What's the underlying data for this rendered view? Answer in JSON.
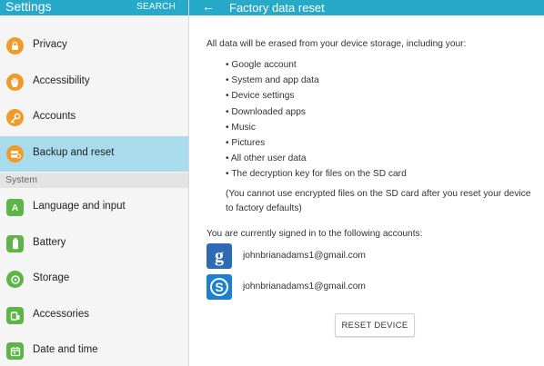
{
  "left_pane": {
    "title": "Settings",
    "search_label": "SEARCH",
    "section_label": "System",
    "items_top": [
      {
        "label": "Privacy",
        "icon": "privacy-icon",
        "color": "#f29a28"
      },
      {
        "label": "Accessibility",
        "icon": "hand-icon",
        "color": "#f29a28"
      },
      {
        "label": "Accounts",
        "icon": "key-icon",
        "color": "#f29a28"
      },
      {
        "label": "Backup and reset",
        "icon": "backup-icon",
        "color": "#f29a28",
        "selected": true
      }
    ],
    "items_system": [
      {
        "label": "Language and input",
        "icon": "language-icon",
        "color": "#5cb646"
      },
      {
        "label": "Battery",
        "icon": "battery-icon",
        "color": "#5cb646"
      },
      {
        "label": "Storage",
        "icon": "storage-icon",
        "color": "#5cb646"
      },
      {
        "label": "Accessories",
        "icon": "accessories-icon",
        "color": "#5cb646"
      },
      {
        "label": "Date and time",
        "icon": "calendar-icon",
        "color": "#5cb646"
      }
    ]
  },
  "right_pane": {
    "title": "Factory data reset",
    "intro": "All data will be erased from your device storage, including your:",
    "bullets": [
      "• Google account",
      "• System and app data",
      "• Device settings",
      "• Downloaded apps",
      "• Music",
      "• Pictures",
      "• All other user data",
      "• The decryption key for files on the SD card"
    ],
    "note": "(You cannot use encrypted files on the SD card after you reset your device to factory defaults)",
    "signed_in_text": "You are currently signed in to the following accounts:",
    "accounts": [
      {
        "email": "johnbrianadams1@gmail.com",
        "icon": "google-icon"
      },
      {
        "email": "johnbrianadams1@gmail.com",
        "icon": "skype-icon"
      }
    ],
    "reset_button": "RESET DEVICE"
  },
  "colors": {
    "header": "#27a9c8",
    "selected_item": "#a8dced",
    "general_icon": "#f29a28",
    "system_icon": "#5cb646"
  }
}
